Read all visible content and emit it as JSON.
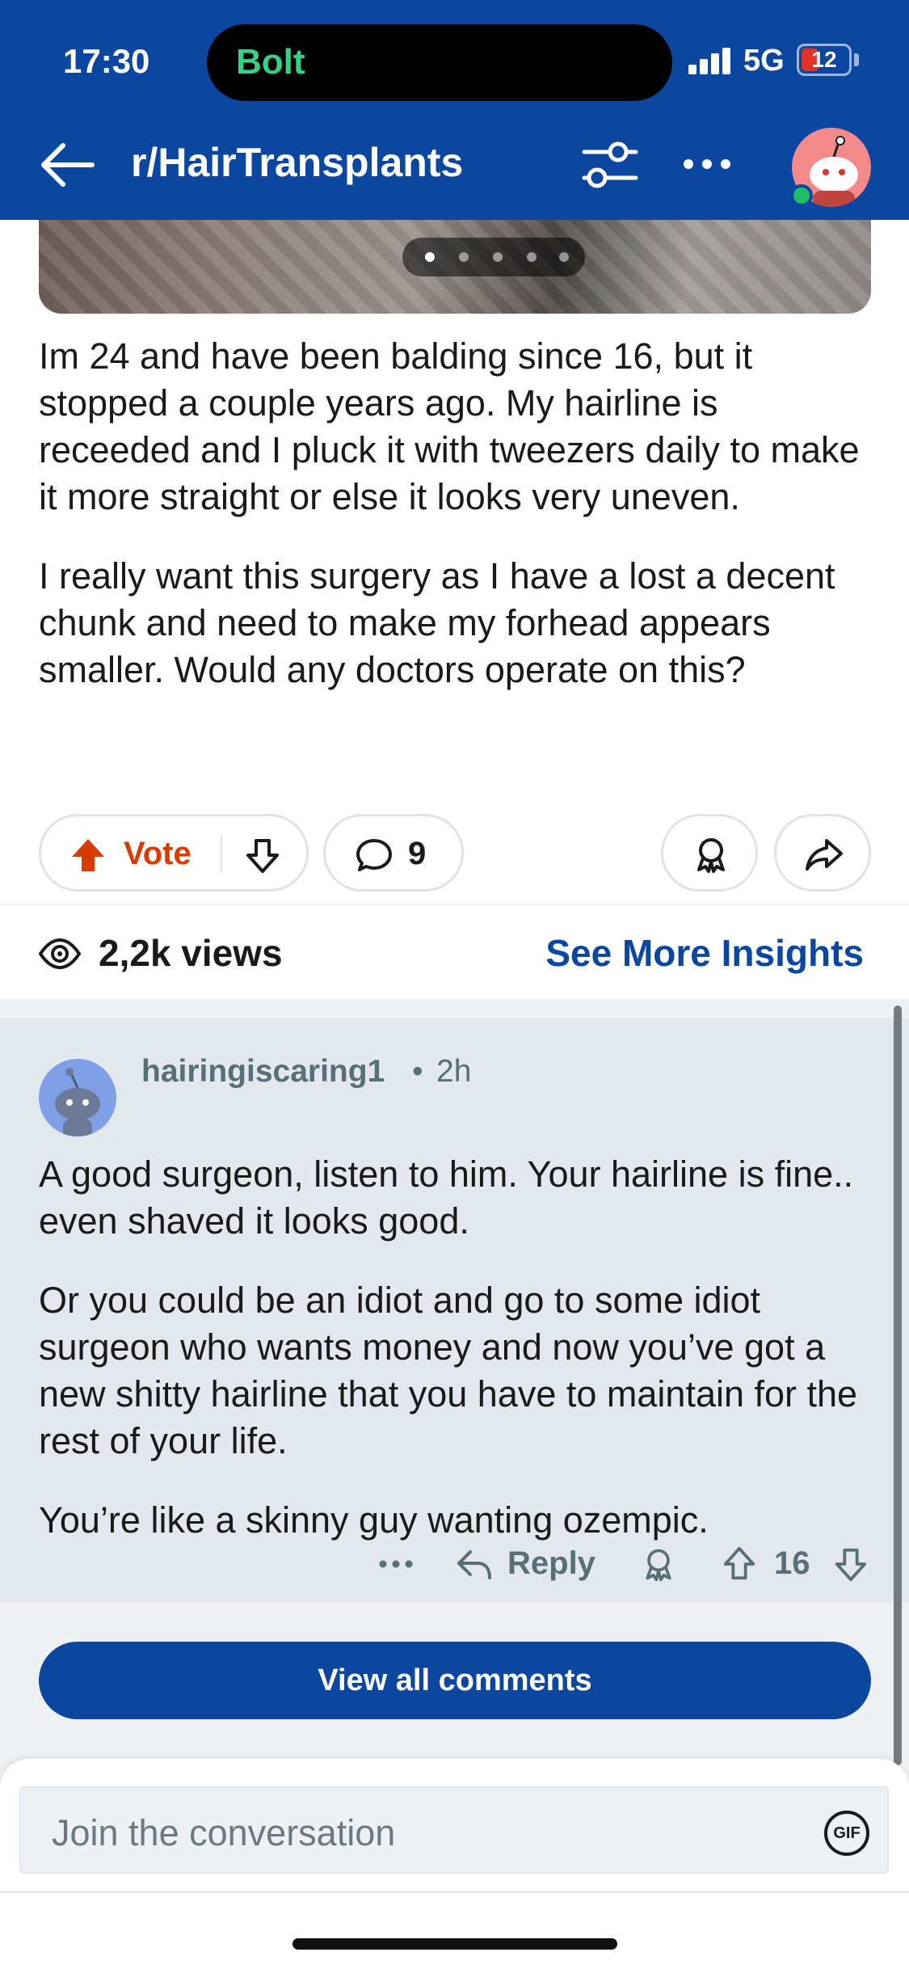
{
  "status_bar": {
    "time": "17:30",
    "island_app": "Bolt",
    "network": "5G",
    "battery": "12"
  },
  "header": {
    "subreddit": "r/HairTransplants"
  },
  "post": {
    "carousel": {
      "count": 5,
      "active_index": 0
    },
    "paragraphs": [
      "Im 24 and have been balding since 16, but it stopped a couple years ago. My hairline is receeded and I pluck it with tweezers daily to make it more straight or else it looks very uneven.",
      "I really want this surgery as I have a lost a decent chunk and need to make my forhead appears smaller. Would any doctors operate on this?"
    ],
    "vote_label": "Vote",
    "comment_count": "9",
    "views": "2,2k views",
    "insights_link": "See More Insights"
  },
  "comment": {
    "username": "hairingiscaring1",
    "separator": "•",
    "age": "2h",
    "paragraphs": [
      "A good surgeon, listen to him. Your hairline is fine.. even shaved it looks good.",
      "Or you could be an idiot and go to some idiot surgeon who wants money and now you’ve got a new shitty hairline that you have to maintain for the rest of your life.",
      "You’re like a skinny guy wanting ozempic."
    ],
    "reply_label": "Reply",
    "score": "16"
  },
  "view_all_label": "View all comments",
  "composer": {
    "placeholder": "Join the conversation",
    "gif_label": "GIF"
  },
  "colors": {
    "brand_blue": "#0b46a0",
    "vote_orange": "#d93a00",
    "comment_bg": "#e3e8ee"
  },
  "icons": [
    "back-arrow-icon",
    "filter-icon",
    "more-icon",
    "upvote-icon",
    "downvote-icon",
    "comment-icon",
    "award-icon",
    "share-icon",
    "views-icon",
    "reply-icon",
    "gif-icon"
  ]
}
